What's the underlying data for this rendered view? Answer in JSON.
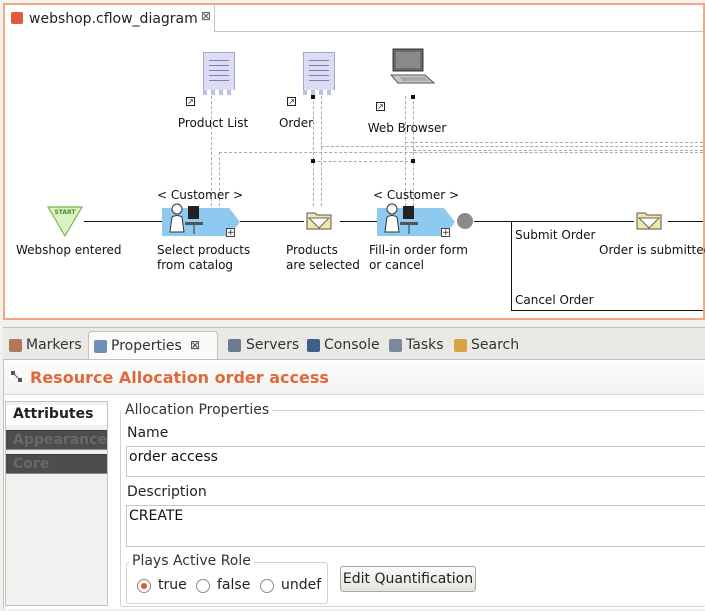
{
  "editor": {
    "tab_title": "webshop.cflow_diagram",
    "close_glyph": "⊠"
  },
  "diagram": {
    "resources": [
      {
        "label": "Product List",
        "icon": "document-icon"
      },
      {
        "label": "Order",
        "icon": "document-icon"
      },
      {
        "label": "Web Browser",
        "icon": "computer-icon"
      }
    ],
    "link_glyph": "↗",
    "role_labels": [
      "< Customer >",
      "< Customer >"
    ],
    "start_badge": "START",
    "start_label": "Webshop entered",
    "tasks": [
      {
        "label_line1": "Select products",
        "label_line2": "from catalog"
      },
      {
        "label_line1": "Fill-in order form",
        "label_line2": "or cancel"
      }
    ],
    "events": [
      {
        "label_line1": "Products",
        "label_line2": "are selected"
      },
      {
        "label_line1": "Order is submitted",
        "label_line2": ""
      }
    ],
    "branches": [
      "Submit Order",
      "Cancel Order"
    ],
    "plus_glyph": "+"
  },
  "views": {
    "tabs": [
      {
        "label": "Markers",
        "icon": "markers-icon",
        "color": "#b07a5a"
      },
      {
        "label": "Properties",
        "icon": "properties-icon",
        "color": "#6f8fb8",
        "active": true
      },
      {
        "label": "Servers",
        "icon": "servers-icon",
        "color": "#6b7a8c"
      },
      {
        "label": "Console",
        "icon": "console-icon",
        "color": "#3d5f8a"
      },
      {
        "label": "Tasks",
        "icon": "tasks-icon",
        "color": "#7a8a9a"
      },
      {
        "label": "Search",
        "icon": "search-icon",
        "color": "#d9a441"
      }
    ],
    "close_glyph": "⊠"
  },
  "properties": {
    "title": "Resource Allocation order access",
    "side_tabs": [
      "Attributes",
      "Appearance",
      "Core"
    ],
    "group_title": "Allocation Properties",
    "name_label": "Name",
    "name_value": "order access",
    "description_label": "Description",
    "description_value": "CREATE",
    "role_group_title": "Plays Active Role",
    "role_options": [
      {
        "label": "true",
        "selected": true
      },
      {
        "label": "false",
        "selected": false
      },
      {
        "label": "undef",
        "selected": false
      }
    ],
    "edit_button": "Edit Quantification"
  },
  "colors": {
    "accent": "#e06a3d",
    "editor_border": "#f2a882",
    "task_fill": "#8ec9ef"
  }
}
